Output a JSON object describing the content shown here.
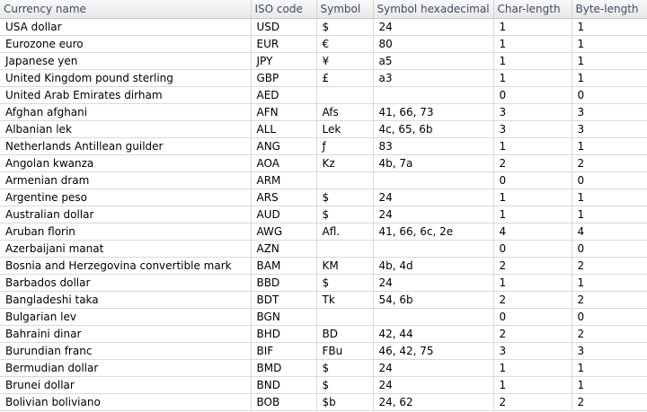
{
  "columns": [
    "Currency name",
    "ISO code",
    "Symbol",
    "Symbol hexadecimal",
    "Char-length",
    "Byte-length"
  ],
  "rows": [
    [
      "USA dollar",
      "USD",
      "$",
      "24",
      "1",
      "1"
    ],
    [
      "Eurozone euro",
      "EUR",
      "€",
      "80",
      "1",
      "1"
    ],
    [
      "Japanese yen",
      "JPY",
      "¥",
      "a5",
      "1",
      "1"
    ],
    [
      "United Kingdom pound sterling",
      "GBP",
      "£",
      "a3",
      "1",
      "1"
    ],
    [
      "United Arab Emirates dirham",
      "AED",
      "",
      "",
      "0",
      "0"
    ],
    [
      "Afghan afghani",
      "AFN",
      "Afs",
      "41, 66, 73",
      "3",
      "3"
    ],
    [
      "Albanian lek",
      "ALL",
      "Lek",
      "4c, 65, 6b",
      "3",
      "3"
    ],
    [
      "Netherlands Antillean guilder",
      "ANG",
      "ƒ",
      "83",
      "1",
      "1"
    ],
    [
      "Angolan kwanza",
      "AOA",
      "Kz",
      "4b, 7a",
      "2",
      "2"
    ],
    [
      "Armenian dram",
      "ARM",
      "",
      "",
      "0",
      "0"
    ],
    [
      "Argentine peso",
      "ARS",
      "$",
      "24",
      "1",
      "1"
    ],
    [
      "Australian dollar",
      "AUD",
      "$",
      "24",
      "1",
      "1"
    ],
    [
      "Aruban florin",
      "AWG",
      "Afl.",
      "41, 66, 6c, 2e",
      "4",
      "4"
    ],
    [
      "Azerbaijani manat",
      "AZN",
      "",
      "",
      "0",
      "0"
    ],
    [
      "Bosnia and Herzegovina convertible mark",
      "BAM",
      "KM",
      "4b, 4d",
      "2",
      "2"
    ],
    [
      "Barbados dollar",
      "BBD",
      "$",
      "24",
      "1",
      "1"
    ],
    [
      "Bangladeshi taka",
      "BDT",
      "Tk",
      "54, 6b",
      "2",
      "2"
    ],
    [
      "Bulgarian lev",
      "BGN",
      "",
      "",
      "0",
      "0"
    ],
    [
      "Bahraini dinar",
      "BHD",
      "BD",
      "42, 44",
      "2",
      "2"
    ],
    [
      "Burundian franc",
      "BIF",
      "FBu",
      "46, 42, 75",
      "3",
      "3"
    ],
    [
      "Bermudian dollar",
      "BMD",
      "$",
      "24",
      "1",
      "1"
    ],
    [
      "Brunei dollar",
      "BND",
      "$",
      "24",
      "1",
      "1"
    ],
    [
      "Bolivian boliviano",
      "BOB",
      "$b",
      "24, 62",
      "2",
      "2"
    ]
  ]
}
